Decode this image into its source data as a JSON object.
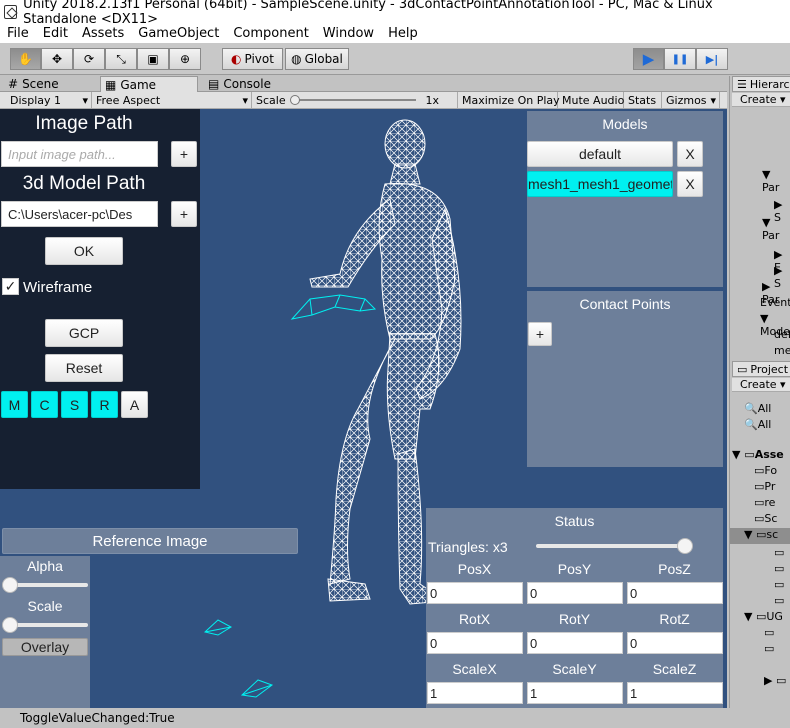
{
  "window": {
    "title": "Unity 2018.2.13f1 Personal (64bit) - SampleScene.unity - 3dContactPointAnnotationTool - PC, Mac & Linux Standalone <DX11>"
  },
  "menu": [
    "File",
    "Edit",
    "Assets",
    "GameObject",
    "Component",
    "Window",
    "Help"
  ],
  "toolbar": {
    "pivot": "Pivot",
    "global": "Global",
    "play": "▶",
    "pause": "❚❚",
    "step": "▶|"
  },
  "tabs": {
    "scene": "Scene",
    "game": "Game",
    "console": "Console"
  },
  "gamebar": {
    "display": "Display 1",
    "aspect": "Free Aspect",
    "scale_label": "Scale",
    "scale_value": "1x",
    "maximize": "Maximize On Play",
    "mute": "Mute Audio",
    "stats": "Stats",
    "gizmos": "Gizmos"
  },
  "left_panel": {
    "image_path_title": "Image Path",
    "image_path_placeholder": "Input image path...",
    "model_path_title": "3d Model Path",
    "model_path_value": "C:\\Users\\acer-pc\\Des",
    "plus": "+",
    "ok": "OK",
    "wireframe_label": "Wireframe",
    "wireframe_checked": true,
    "gcp": "GCP",
    "reset": "Reset",
    "mode_buttons": [
      "M",
      "C",
      "S",
      "R",
      "A"
    ]
  },
  "reference": {
    "title": "Reference Image",
    "alpha": "Alpha",
    "scale": "Scale",
    "overlay": "Overlay"
  },
  "models": {
    "title": "Models",
    "items": [
      "default",
      "mesh1_mesh1_geomet"
    ],
    "remove": "X"
  },
  "contact": {
    "title": "Contact Points",
    "add": "+"
  },
  "status": {
    "title": "Status",
    "triangles": "Triangles: x3",
    "pos_labels": [
      "PosX",
      "PosY",
      "PosZ"
    ],
    "pos_values": [
      "0",
      "0",
      "0"
    ],
    "rot_labels": [
      "RotX",
      "RotY",
      "RotZ"
    ],
    "rot_values": [
      "0",
      "0",
      "0"
    ],
    "scale_labels": [
      "ScaleX",
      "ScaleY",
      "ScaleZ"
    ],
    "scale_values": [
      "1",
      "1",
      "1"
    ]
  },
  "hierarchy": {
    "tab": "Hierarchy",
    "create": "Create",
    "items": [
      "Par",
      "S",
      "Par",
      "E",
      "S",
      "Par",
      "Event",
      "Mode",
      "def",
      "me"
    ]
  },
  "project": {
    "tab": "Project",
    "create": "Create",
    "items": [
      "All",
      "All",
      "Asse",
      "Fo",
      "Pr",
      "re",
      "Sc",
      "sc",
      "UG"
    ]
  },
  "statusbar": {
    "message": "ToggleValueChanged:True"
  },
  "colors": {
    "viewport": "#31517f",
    "panel": "#6d7f9a",
    "dark_panel": "#162031",
    "accent": "#00f0f0"
  }
}
